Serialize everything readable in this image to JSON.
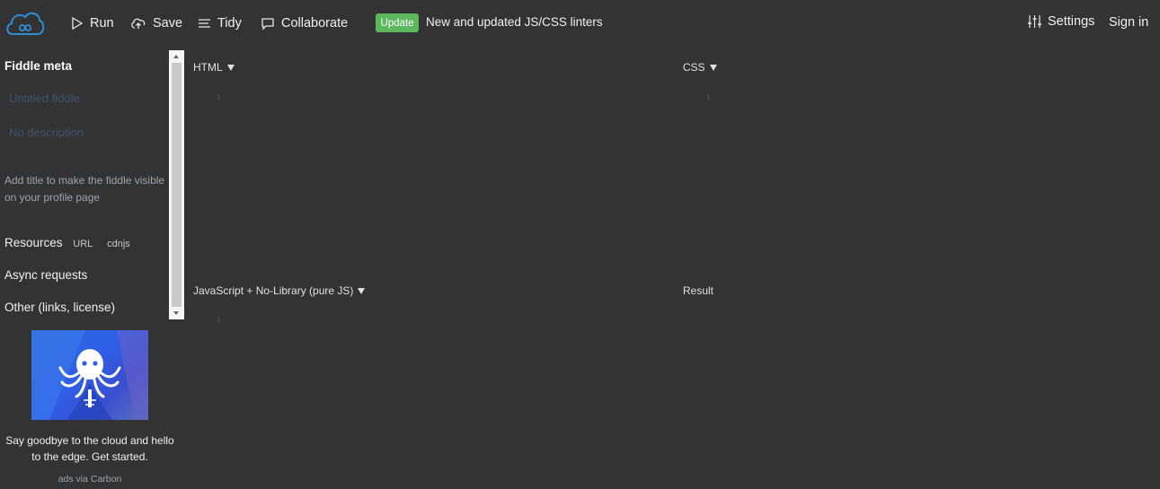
{
  "header": {
    "logo_icon": "cloud-infinity-icon",
    "run_label": "Run",
    "save_label": "Save",
    "tidy_label": "Tidy",
    "collaborate_label": "Collaborate",
    "update_badge": "Update",
    "update_text": "New and updated JS/CSS linters",
    "settings_label": "Settings",
    "signin_label": "Sign in"
  },
  "sidebar": {
    "title": "Fiddle meta",
    "title_placeholder": "Untitled fiddle",
    "description_placeholder": "No description",
    "hint": "Add title to make the fiddle visible on your profile page",
    "resources_label": "Resources",
    "resources_url": "URL",
    "resources_cdnjs": "cdnjs",
    "async_label": "Async requests",
    "other_label": "Other (links, license)"
  },
  "ad": {
    "text": "Say goodbye to the cloud and hello to the edge. Get started.",
    "via": "ads via Carbon"
  },
  "panels": {
    "html_label": "HTML",
    "css_label": "CSS",
    "js_label": "JavaScript + No-Library (pure JS)",
    "result_label": "Result",
    "line_number": "1"
  },
  "colors": {
    "background": "#333333",
    "badge": "#5cb85c",
    "logo": "#2c8fd6"
  }
}
